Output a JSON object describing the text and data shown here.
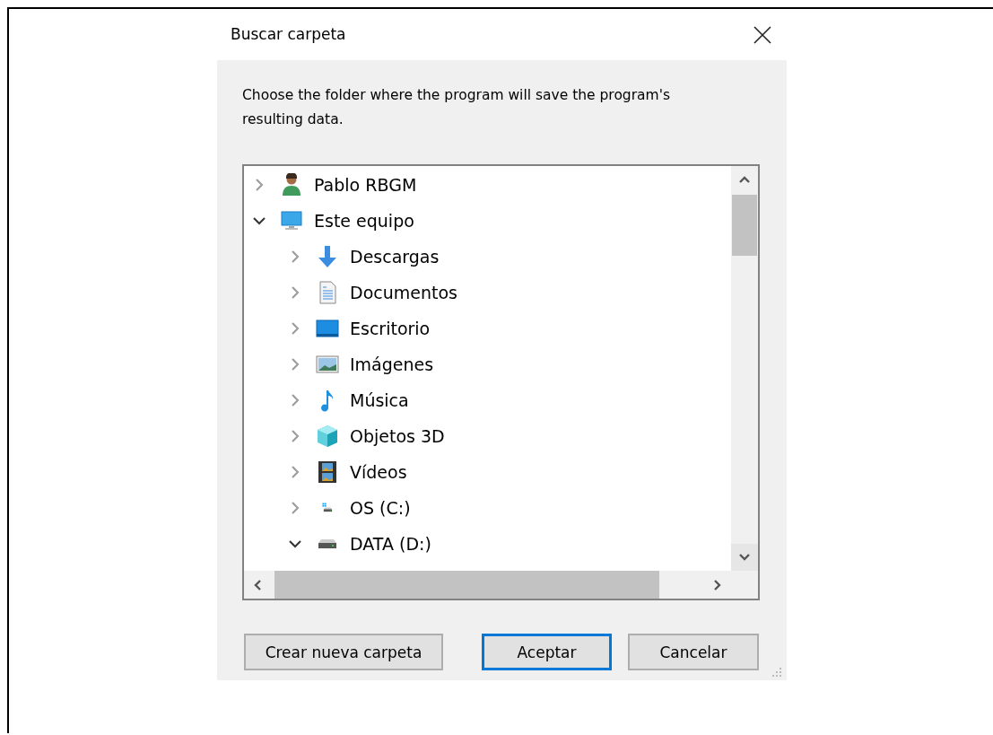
{
  "dialog": {
    "title": "Buscar carpeta",
    "description": "Choose the folder where the program will save the program's resulting data.",
    "tree": [
      {
        "label": "Pablo RBGM",
        "kind": "user",
        "expanded": false
      },
      {
        "label": "Este equipo",
        "kind": "computer",
        "expanded": true,
        "children": [
          {
            "label": "Descargas",
            "kind": "downloads",
            "expanded": false
          },
          {
            "label": "Documentos",
            "kind": "documents",
            "expanded": false
          },
          {
            "label": "Escritorio",
            "kind": "desktop",
            "expanded": false
          },
          {
            "label": "Imágenes",
            "kind": "pictures",
            "expanded": false
          },
          {
            "label": "Música",
            "kind": "music",
            "expanded": false
          },
          {
            "label": "Objetos 3D",
            "kind": "objects",
            "expanded": false
          },
          {
            "label": "Vídeos",
            "kind": "videos",
            "expanded": false
          },
          {
            "label": "OS (C:)",
            "kind": "systemdrive",
            "expanded": false
          },
          {
            "label": "DATA (D:)",
            "kind": "drive",
            "expanded": true
          }
        ]
      }
    ],
    "buttons": [
      {
        "label": "Crear nueva carpeta",
        "default": false
      },
      {
        "label": "Aceptar",
        "default": true
      },
      {
        "label": "Cancelar",
        "default": false
      }
    ]
  }
}
